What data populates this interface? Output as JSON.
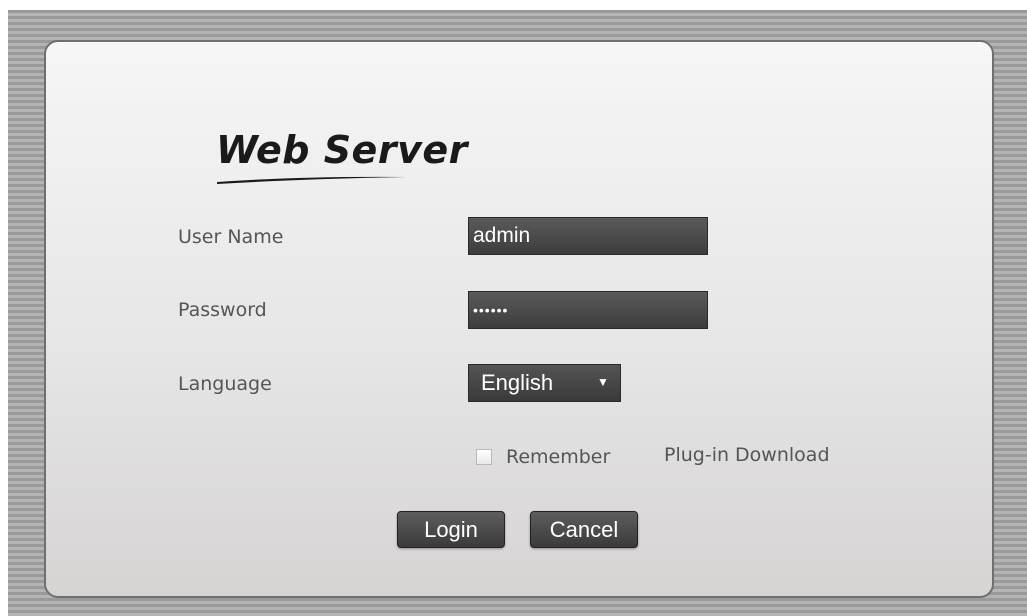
{
  "logo": {
    "text": "Web Server"
  },
  "form": {
    "username": {
      "label": "User Name",
      "value": "admin"
    },
    "password": {
      "label": "Password",
      "value": "••••••"
    },
    "language": {
      "label": "Language",
      "selected": "English",
      "arrow": "▼"
    },
    "remember": {
      "label": "Remember",
      "checked": false
    },
    "plugin_download": "Plug-in Download"
  },
  "buttons": {
    "login": "Login",
    "cancel": "Cancel"
  },
  "colors": {
    "field_bg": "#3d3d3d",
    "label_text": "#555555",
    "panel_bg": "#e6e6e6",
    "frame_stripes": "#9a9a9a"
  }
}
